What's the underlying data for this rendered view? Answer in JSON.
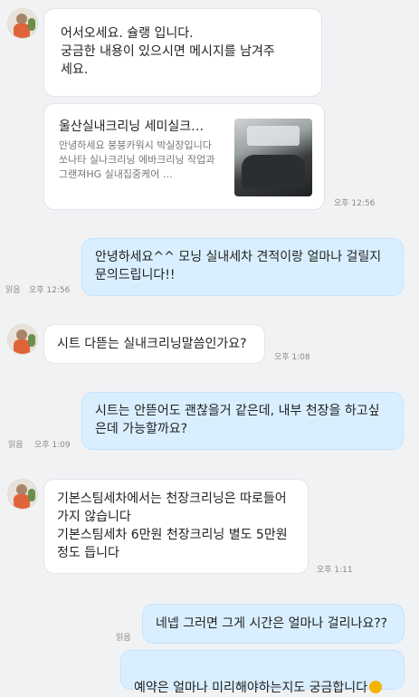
{
  "messages": {
    "m1": {
      "text": "어서오세요. 슐랭 입니다.\n궁금한 내용이 있으시면 메시지를 남겨주\n세요."
    },
    "card": {
      "title": "울산실내크리닝 세미실크…",
      "desc": "안녕하세요 붕붕카워시 박실장입니다 쏘나타 실나크리닝 에바크리닝 작업과 그랜져HG 실내집중케어 …",
      "time": "오후 12:56"
    },
    "m2": {
      "text": "안녕하세요^^ 모닝 실내세차 견적이랑 얼마나 걸릴지\n문의드립니다!!",
      "read": "읽음",
      "time": "오후 12:56"
    },
    "m3": {
      "text": "시트 다뜯는 실내크리닝말씀인가요?",
      "time": "오후 1:08"
    },
    "m4": {
      "text": "시트는 안뜯어도 괜찮을거 같은데, 내부 천장을 하고싶\n은데 가능할까요?",
      "read": "읽음",
      "time": "오후 1:09"
    },
    "m5": {
      "text": "기본스팀세차에서는 천장크리닝은 따로들어\n가지 않습니다\n기본스팀세차 6만원 천장크리닝 별도 5만원\n정도 듭니다",
      "time": "오후 1:11"
    },
    "m6": {
      "text": "네넵 그러면 그게 시간은 얼마나 걸리나요??",
      "read": "읽음"
    },
    "m7": {
      "text": "예약은 얼마나 미리해야하는지도 궁금합니다"
    }
  }
}
